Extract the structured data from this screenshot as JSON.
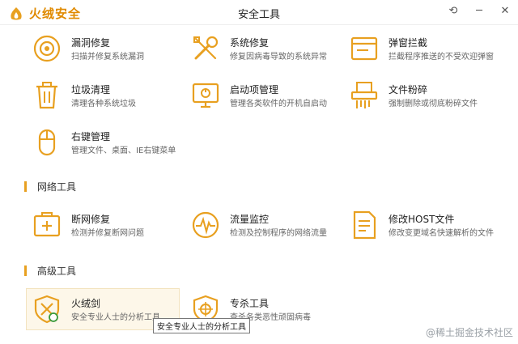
{
  "app": {
    "logo_text": "火绒安全",
    "window_title": "安全工具"
  },
  "window_controls": {
    "back": "⟲",
    "minimize": "─",
    "close": "✕"
  },
  "tools_system": [
    {
      "name": "漏洞修复",
      "desc": "扫描并修复系统漏洞",
      "icon": "vulnerability-repair-icon"
    },
    {
      "name": "系统修复",
      "desc": "修复因病毒导致的系统异常",
      "icon": "system-repair-icon"
    },
    {
      "name": "弹窗拦截",
      "desc": "拦截程序推送的不受欢迎弹窗",
      "icon": "popup-block-icon"
    },
    {
      "name": "垃圾清理",
      "desc": "清理各种系统垃圾",
      "icon": "trash-clean-icon"
    },
    {
      "name": "启动项管理",
      "desc": "管理各类软件的开机自启动",
      "icon": "startup-manager-icon"
    },
    {
      "name": "文件粉碎",
      "desc": "强制删除或彻底粉碎文件",
      "icon": "file-shredder-icon"
    },
    {
      "name": "右键管理",
      "desc": "管理文件、桌面、IE右键菜单",
      "icon": "right-click-manager-icon"
    }
  ],
  "section_network": {
    "label": "网络工具"
  },
  "tools_network": [
    {
      "name": "断网修复",
      "desc": "检测并修复断网问题",
      "icon": "network-repair-icon"
    },
    {
      "name": "流量监控",
      "desc": "检测及控制程序的网络流量",
      "icon": "traffic-monitor-icon"
    },
    {
      "name": "修改HOST文件",
      "desc": "修改变更域名快速解析的文件",
      "icon": "host-file-icon"
    }
  ],
  "section_advanced": {
    "label": "高级工具"
  },
  "tools_advanced": [
    {
      "name": "火绒剑",
      "desc": "安全专业人士的分析工具",
      "icon": "huorong-sword-icon"
    },
    {
      "name": "专杀工具",
      "desc": "查杀各类恶性顽固病毒",
      "icon": "special-kill-icon"
    }
  ],
  "tooltip": {
    "text": "安全专业人士的分析工具"
  },
  "watermark": {
    "text": "@稀土掘金技术社区"
  },
  "colors": {
    "accent": "#e8a020",
    "highlight_bg": "#fdf7e9"
  }
}
